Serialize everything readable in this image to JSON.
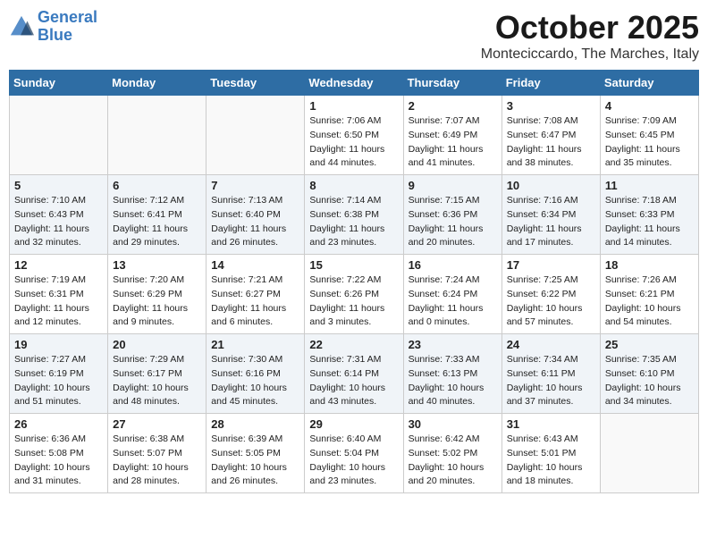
{
  "header": {
    "logo_line1": "General",
    "logo_line2": "Blue",
    "month": "October 2025",
    "location": "Monteciccardo, The Marches, Italy"
  },
  "days_of_week": [
    "Sunday",
    "Monday",
    "Tuesday",
    "Wednesday",
    "Thursday",
    "Friday",
    "Saturday"
  ],
  "weeks": [
    [
      {
        "num": "",
        "sunrise": "",
        "sunset": "",
        "daylight": ""
      },
      {
        "num": "",
        "sunrise": "",
        "sunset": "",
        "daylight": ""
      },
      {
        "num": "",
        "sunrise": "",
        "sunset": "",
        "daylight": ""
      },
      {
        "num": "1",
        "sunrise": "Sunrise: 7:06 AM",
        "sunset": "Sunset: 6:50 PM",
        "daylight": "Daylight: 11 hours and 44 minutes."
      },
      {
        "num": "2",
        "sunrise": "Sunrise: 7:07 AM",
        "sunset": "Sunset: 6:49 PM",
        "daylight": "Daylight: 11 hours and 41 minutes."
      },
      {
        "num": "3",
        "sunrise": "Sunrise: 7:08 AM",
        "sunset": "Sunset: 6:47 PM",
        "daylight": "Daylight: 11 hours and 38 minutes."
      },
      {
        "num": "4",
        "sunrise": "Sunrise: 7:09 AM",
        "sunset": "Sunset: 6:45 PM",
        "daylight": "Daylight: 11 hours and 35 minutes."
      }
    ],
    [
      {
        "num": "5",
        "sunrise": "Sunrise: 7:10 AM",
        "sunset": "Sunset: 6:43 PM",
        "daylight": "Daylight: 11 hours and 32 minutes."
      },
      {
        "num": "6",
        "sunrise": "Sunrise: 7:12 AM",
        "sunset": "Sunset: 6:41 PM",
        "daylight": "Daylight: 11 hours and 29 minutes."
      },
      {
        "num": "7",
        "sunrise": "Sunrise: 7:13 AM",
        "sunset": "Sunset: 6:40 PM",
        "daylight": "Daylight: 11 hours and 26 minutes."
      },
      {
        "num": "8",
        "sunrise": "Sunrise: 7:14 AM",
        "sunset": "Sunset: 6:38 PM",
        "daylight": "Daylight: 11 hours and 23 minutes."
      },
      {
        "num": "9",
        "sunrise": "Sunrise: 7:15 AM",
        "sunset": "Sunset: 6:36 PM",
        "daylight": "Daylight: 11 hours and 20 minutes."
      },
      {
        "num": "10",
        "sunrise": "Sunrise: 7:16 AM",
        "sunset": "Sunset: 6:34 PM",
        "daylight": "Daylight: 11 hours and 17 minutes."
      },
      {
        "num": "11",
        "sunrise": "Sunrise: 7:18 AM",
        "sunset": "Sunset: 6:33 PM",
        "daylight": "Daylight: 11 hours and 14 minutes."
      }
    ],
    [
      {
        "num": "12",
        "sunrise": "Sunrise: 7:19 AM",
        "sunset": "Sunset: 6:31 PM",
        "daylight": "Daylight: 11 hours and 12 minutes."
      },
      {
        "num": "13",
        "sunrise": "Sunrise: 7:20 AM",
        "sunset": "Sunset: 6:29 PM",
        "daylight": "Daylight: 11 hours and 9 minutes."
      },
      {
        "num": "14",
        "sunrise": "Sunrise: 7:21 AM",
        "sunset": "Sunset: 6:27 PM",
        "daylight": "Daylight: 11 hours and 6 minutes."
      },
      {
        "num": "15",
        "sunrise": "Sunrise: 7:22 AM",
        "sunset": "Sunset: 6:26 PM",
        "daylight": "Daylight: 11 hours and 3 minutes."
      },
      {
        "num": "16",
        "sunrise": "Sunrise: 7:24 AM",
        "sunset": "Sunset: 6:24 PM",
        "daylight": "Daylight: 11 hours and 0 minutes."
      },
      {
        "num": "17",
        "sunrise": "Sunrise: 7:25 AM",
        "sunset": "Sunset: 6:22 PM",
        "daylight": "Daylight: 10 hours and 57 minutes."
      },
      {
        "num": "18",
        "sunrise": "Sunrise: 7:26 AM",
        "sunset": "Sunset: 6:21 PM",
        "daylight": "Daylight: 10 hours and 54 minutes."
      }
    ],
    [
      {
        "num": "19",
        "sunrise": "Sunrise: 7:27 AM",
        "sunset": "Sunset: 6:19 PM",
        "daylight": "Daylight: 10 hours and 51 minutes."
      },
      {
        "num": "20",
        "sunrise": "Sunrise: 7:29 AM",
        "sunset": "Sunset: 6:17 PM",
        "daylight": "Daylight: 10 hours and 48 minutes."
      },
      {
        "num": "21",
        "sunrise": "Sunrise: 7:30 AM",
        "sunset": "Sunset: 6:16 PM",
        "daylight": "Daylight: 10 hours and 45 minutes."
      },
      {
        "num": "22",
        "sunrise": "Sunrise: 7:31 AM",
        "sunset": "Sunset: 6:14 PM",
        "daylight": "Daylight: 10 hours and 43 minutes."
      },
      {
        "num": "23",
        "sunrise": "Sunrise: 7:33 AM",
        "sunset": "Sunset: 6:13 PM",
        "daylight": "Daylight: 10 hours and 40 minutes."
      },
      {
        "num": "24",
        "sunrise": "Sunrise: 7:34 AM",
        "sunset": "Sunset: 6:11 PM",
        "daylight": "Daylight: 10 hours and 37 minutes."
      },
      {
        "num": "25",
        "sunrise": "Sunrise: 7:35 AM",
        "sunset": "Sunset: 6:10 PM",
        "daylight": "Daylight: 10 hours and 34 minutes."
      }
    ],
    [
      {
        "num": "26",
        "sunrise": "Sunrise: 6:36 AM",
        "sunset": "Sunset: 5:08 PM",
        "daylight": "Daylight: 10 hours and 31 minutes."
      },
      {
        "num": "27",
        "sunrise": "Sunrise: 6:38 AM",
        "sunset": "Sunset: 5:07 PM",
        "daylight": "Daylight: 10 hours and 28 minutes."
      },
      {
        "num": "28",
        "sunrise": "Sunrise: 6:39 AM",
        "sunset": "Sunset: 5:05 PM",
        "daylight": "Daylight: 10 hours and 26 minutes."
      },
      {
        "num": "29",
        "sunrise": "Sunrise: 6:40 AM",
        "sunset": "Sunset: 5:04 PM",
        "daylight": "Daylight: 10 hours and 23 minutes."
      },
      {
        "num": "30",
        "sunrise": "Sunrise: 6:42 AM",
        "sunset": "Sunset: 5:02 PM",
        "daylight": "Daylight: 10 hours and 20 minutes."
      },
      {
        "num": "31",
        "sunrise": "Sunrise: 6:43 AM",
        "sunset": "Sunset: 5:01 PM",
        "daylight": "Daylight: 10 hours and 18 minutes."
      },
      {
        "num": "",
        "sunrise": "",
        "sunset": "",
        "daylight": ""
      }
    ]
  ]
}
